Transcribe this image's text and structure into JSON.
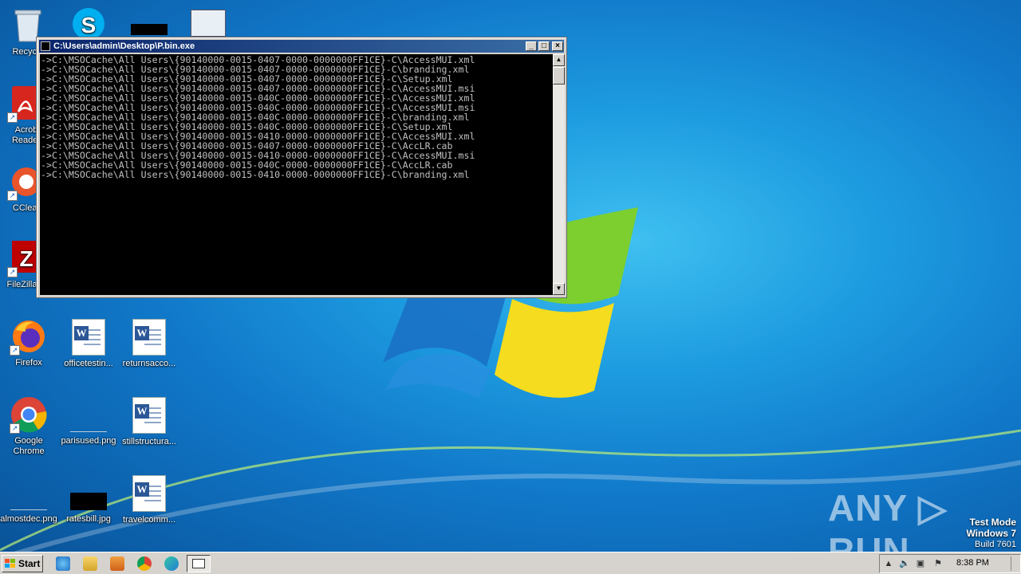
{
  "console": {
    "title": "C:\\Users\\admin\\Desktop\\P.bin.exe",
    "lines": [
      "->C:\\MSOCache\\All Users\\{90140000-0015-0407-0000-0000000FF1CE}-C\\AccessMUI.xml",
      "->C:\\MSOCache\\All Users\\{90140000-0015-0407-0000-0000000FF1CE}-C\\branding.xml",
      "->C:\\MSOCache\\All Users\\{90140000-0015-0407-0000-0000000FF1CE}-C\\Setup.xml",
      "->C:\\MSOCache\\All Users\\{90140000-0015-0407-0000-0000000FF1CE}-C\\AccessMUI.msi",
      "->C:\\MSOCache\\All Users\\{90140000-0015-040C-0000-0000000FF1CE}-C\\AccessMUI.xml",
      "->C:\\MSOCache\\All Users\\{90140000-0015-040C-0000-0000000FF1CE}-C\\AccessMUI.msi",
      "->C:\\MSOCache\\All Users\\{90140000-0015-040C-0000-0000000FF1CE}-C\\branding.xml",
      "->C:\\MSOCache\\All Users\\{90140000-0015-040C-0000-0000000FF1CE}-C\\Setup.xml",
      "->C:\\MSOCache\\All Users\\{90140000-0015-0410-0000-0000000FF1CE}-C\\AccessMUI.xml",
      "->C:\\MSOCache\\All Users\\{90140000-0015-0407-0000-0000000FF1CE}-C\\AccLR.cab",
      "->C:\\MSOCache\\All Users\\{90140000-0015-0410-0000-0000000FF1CE}-C\\AccessMUI.msi",
      "->C:\\MSOCache\\All Users\\{90140000-0015-040C-0000-0000000FF1CE}-C\\AccLR.cab",
      "->C:\\MSOCache\\All Users\\{90140000-0015-0410-0000-0000000FF1CE}-C\\branding.xml"
    ]
  },
  "desktop_icons": {
    "recycle": "Recycle",
    "acrobat_1": "Acrob",
    "acrobat_2": "Reader",
    "ccleaner": "CClear",
    "filezilla": "FileZilla C",
    "firefox": "Firefox",
    "officetesting": "officetestin...",
    "returnsacco": "returnsacco...",
    "chrome_1": "Google",
    "chrome_2": "Chrome",
    "parisused": "parisused.png",
    "stillstructura": "stillstructura...",
    "almostdec": "almostdec.png",
    "ratesbill": "ratesbill.jpg",
    "travelcomm": "travelcomm..."
  },
  "watermark": "ANY ▷ RUN",
  "test_mode": {
    "line1": "Test Mode",
    "line2": "Windows 7",
    "line3": "Build 7601"
  },
  "taskbar": {
    "start_label": "Start",
    "clock": "8:38 PM"
  },
  "colors": {
    "console_bg": "#000000",
    "console_fg": "#c0c0c0",
    "titlebar_start": "#0a246a",
    "titlebar_end": "#3a6ea5",
    "desktop": "#1178c9"
  }
}
